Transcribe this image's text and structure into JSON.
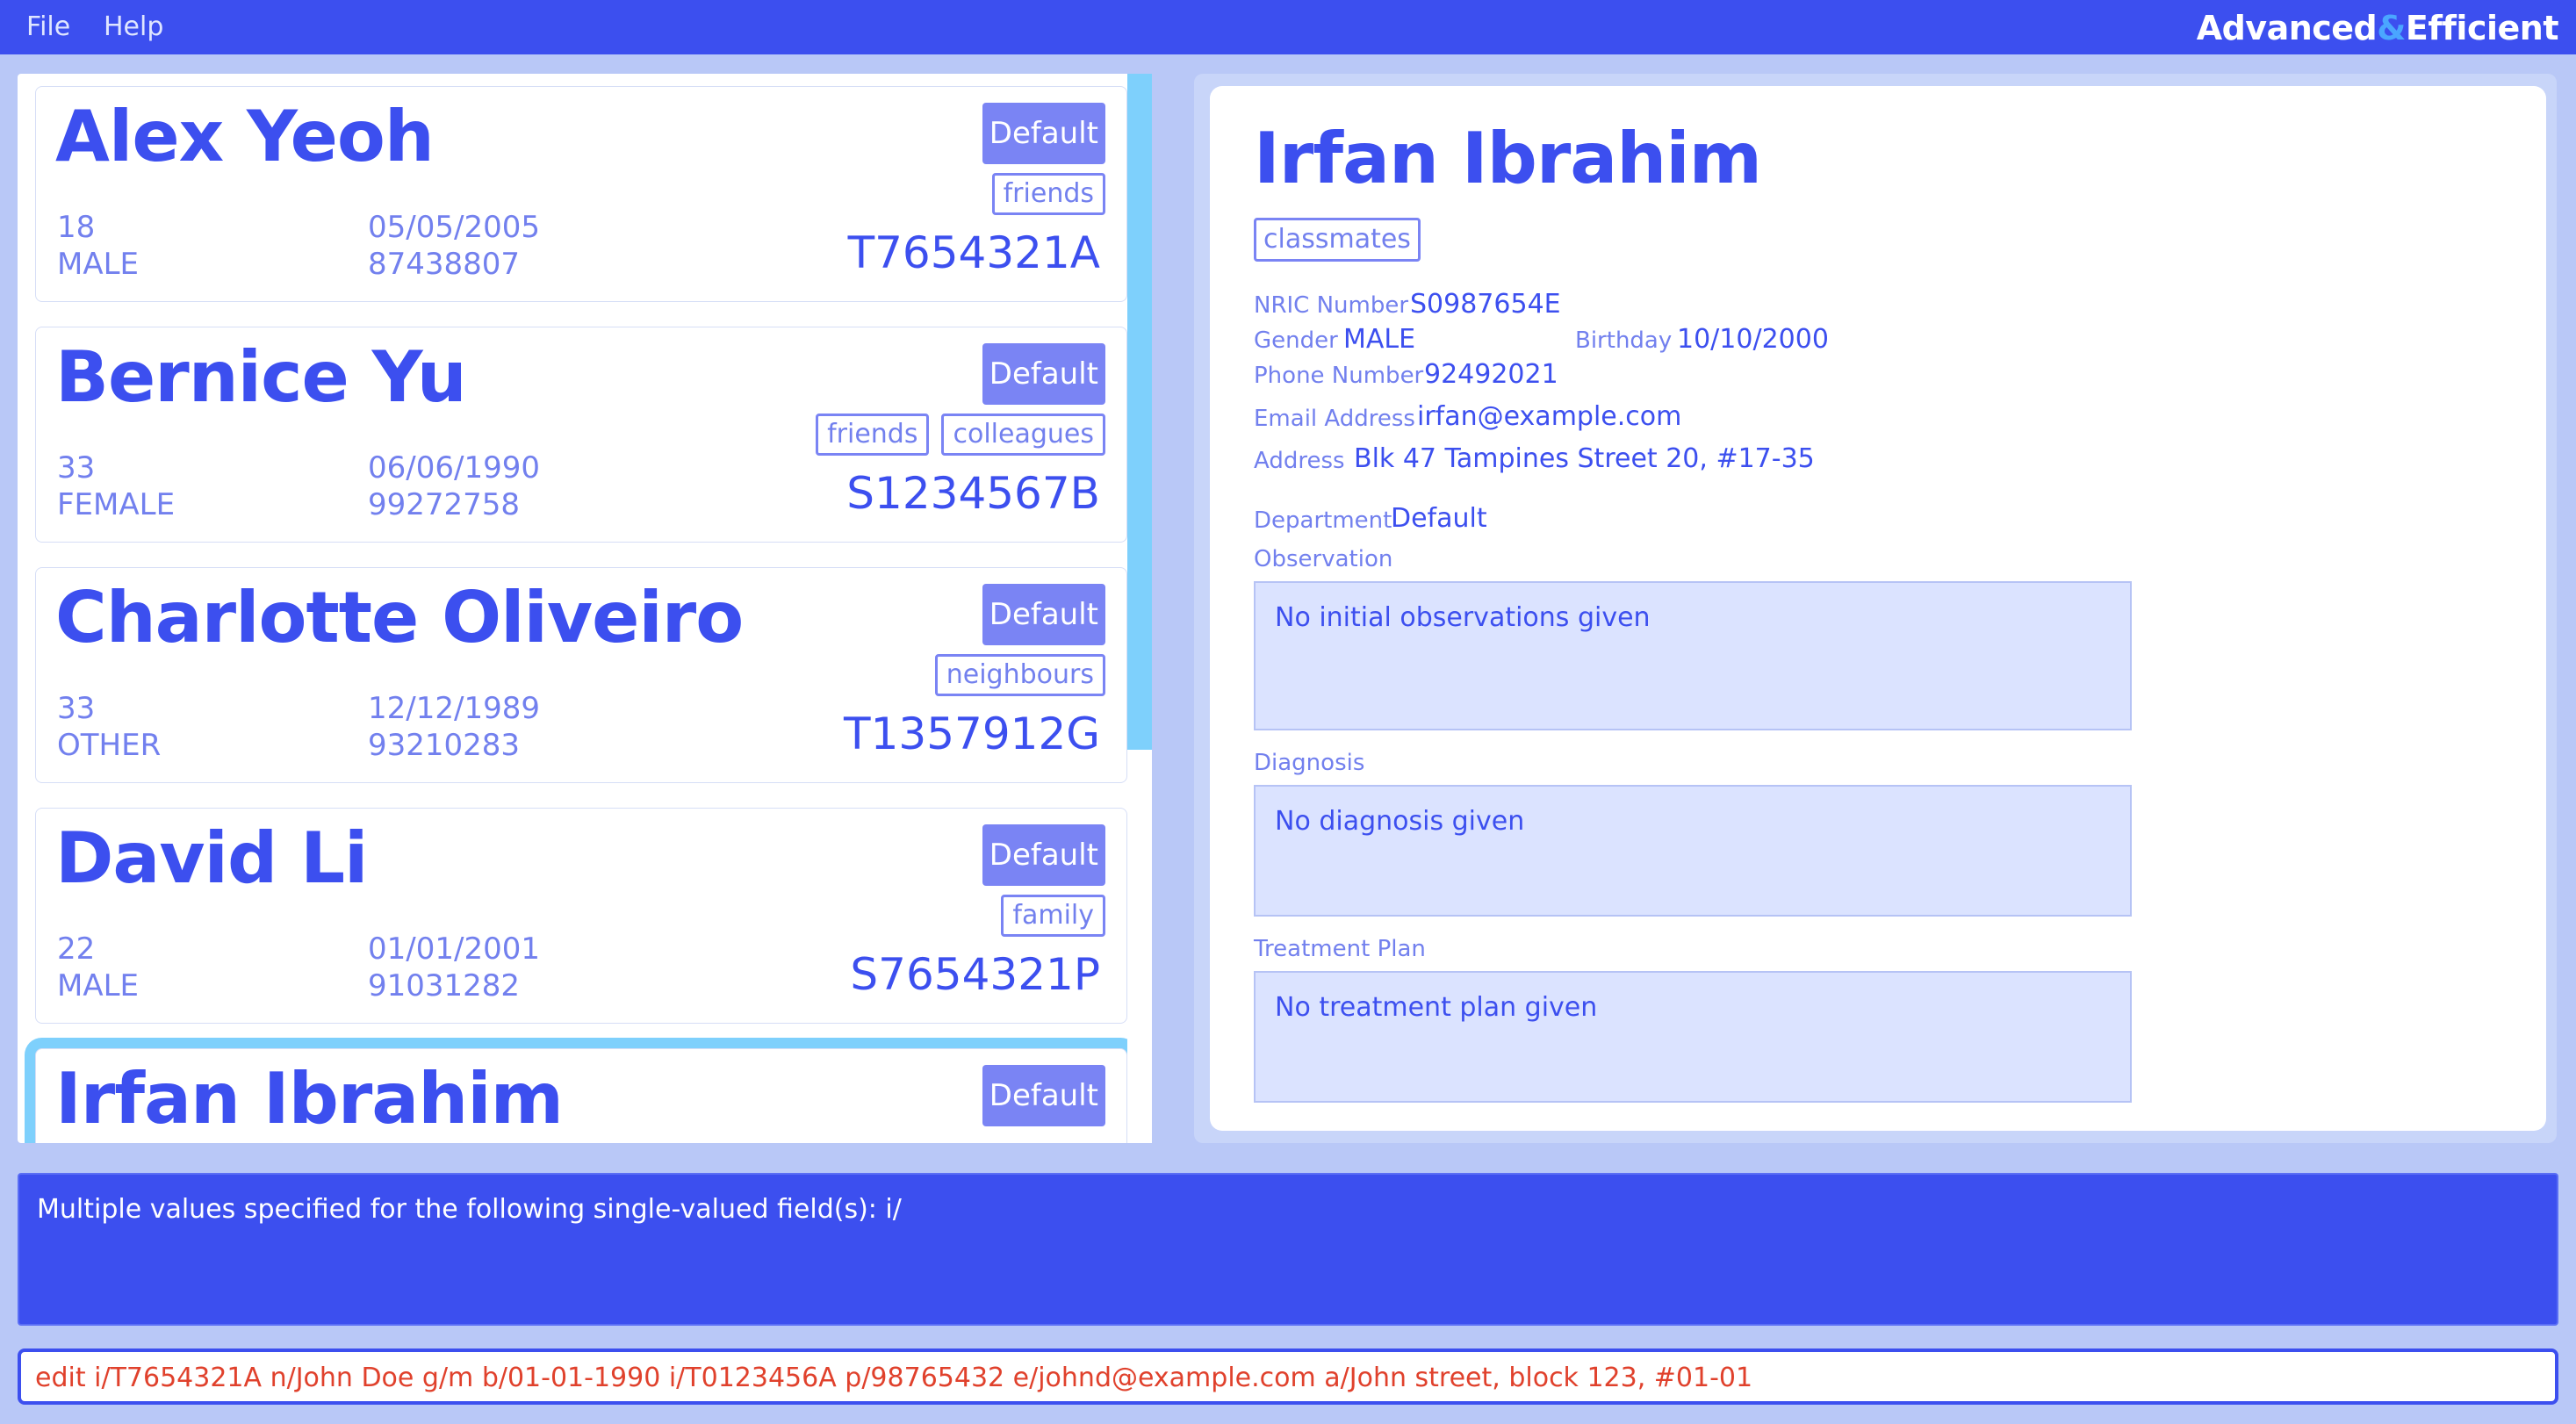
{
  "menu": {
    "file": "File",
    "help": "Help"
  },
  "brand": {
    "part1": "Advanced",
    "amp": "&",
    "part2": "Efficient"
  },
  "persons": [
    {
      "name": "Alex Yeoh",
      "age": "18",
      "gender": "MALE",
      "birthday": "05/05/2005",
      "phone": "87438807",
      "nric": "T7654321A",
      "department": "Default",
      "tags": [
        "friends"
      ]
    },
    {
      "name": "Bernice Yu",
      "age": "33",
      "gender": "FEMALE",
      "birthday": "06/06/1990",
      "phone": "99272758",
      "nric": "S1234567B",
      "department": "Default",
      "tags": [
        "friends",
        "colleagues"
      ]
    },
    {
      "name": "Charlotte Oliveiro",
      "age": "33",
      "gender": "OTHER",
      "birthday": "12/12/1989",
      "phone": "93210283",
      "nric": "T1357912G",
      "department": "Default",
      "tags": [
        "neighbours"
      ]
    },
    {
      "name": "David Li",
      "age": "22",
      "gender": "MALE",
      "birthday": "01/01/2001",
      "phone": "91031282",
      "nric": "S7654321P",
      "department": "Default",
      "tags": [
        "family"
      ]
    },
    {
      "name": "Irfan Ibrahim",
      "department": "Default"
    }
  ],
  "detail": {
    "name": "Irfan Ibrahim",
    "tag": "classmates",
    "nric_label": "NRIC Number",
    "nric": "S0987654E",
    "gender_label": "Gender",
    "gender": "MALE",
    "birthday_label": "Birthday",
    "birthday": "10/10/2000",
    "phone_label": "Phone Number",
    "phone": "92492021",
    "email_label": "Email Address",
    "email": "irfan@example.com",
    "address_label": "Address",
    "address": "Blk 47 Tampines Street 20, #17-35",
    "department_label": "Department",
    "department": "Default",
    "observation_label": "Observation",
    "observation": "No initial observations given",
    "diagnosis_label": "Diagnosis",
    "diagnosis": "No diagnosis given",
    "treatment_label": "Treatment Plan",
    "treatment": "No treatment plan given"
  },
  "result": "Multiple values specified for the following single-valued field(s): i/",
  "command": "edit i/T7654321A n/John Doe g/m b/01-01-1990 i/T0123456A p/98765432 e/johnd@example.com a/John street, block 123, #01-01",
  "colors": {
    "accent": "#3c4fef",
    "background": "#b9c8f7",
    "selected": "#7ed0fc",
    "command_text": "#e0412c"
  }
}
